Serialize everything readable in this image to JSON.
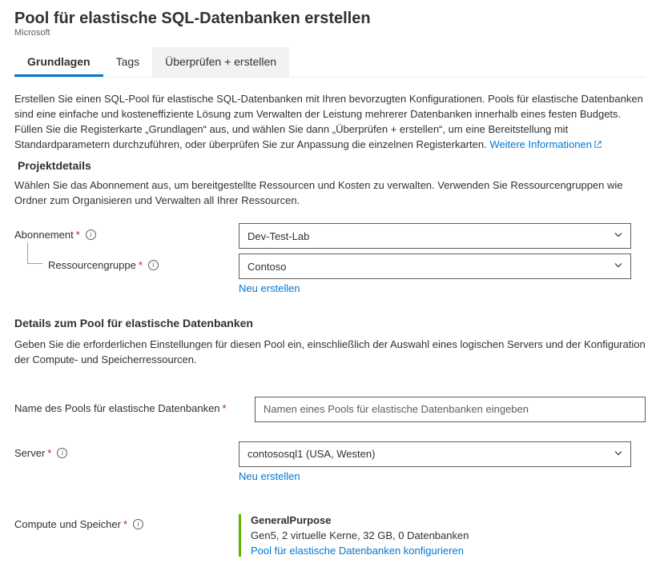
{
  "header": {
    "title": "Pool für elastische SQL-Datenbanken erstellen",
    "vendor": "Microsoft"
  },
  "tabs": {
    "basics": "Grundlagen",
    "tags": "Tags",
    "review": "Überprüfen + erstellen"
  },
  "intro": {
    "text": "Erstellen Sie einen SQL-Pool für elastische SQL-Datenbanken mit Ihren bevorzugten Konfigurationen. Pools für elastische Datenbanken sind eine einfache und kosteneffiziente Lösung zum Verwalten der Leistung mehrerer Datenbanken innerhalb eines festen Budgets. Füllen Sie die Registerkarte „Grundlagen“ aus, und wählen Sie dann „Überprüfen + erstellen“, um eine Bereitstellung mit Standardparametern durchzuführen, oder überprüfen Sie zur Anpassung die einzelnen Registerkarten. ",
    "link": "Weitere Informationen"
  },
  "project": {
    "heading": "Projektdetails",
    "desc": "Wählen Sie das Abonnement aus, um bereitgestellte Ressourcen und Kosten zu verwalten. Verwenden Sie Ressourcengruppen wie Ordner zum Organisieren und Verwalten all Ihrer Ressourcen.",
    "subscription_label": "Abonnement",
    "subscription_value": "Dev-Test-Lab",
    "rg_label": "Ressourcengruppe",
    "rg_value": "Contoso",
    "create_new": "Neu erstellen"
  },
  "pool": {
    "heading": "Details zum Pool für elastische Datenbanken",
    "desc": "Geben Sie die erforderlichen Einstellungen für diesen Pool ein, einschließlich der Auswahl eines logischen Servers und der Konfiguration der Compute- und Speicherressourcen.",
    "name_label": "Name des Pools für elastische Datenbanken",
    "name_placeholder": "Namen eines Pools für elastische Datenbanken eingeben",
    "server_label": "Server",
    "server_value": "contososql1 (USA, Westen)",
    "create_new": "Neu erstellen",
    "compute_label": "Compute und Speicher",
    "compute_title": "GeneralPurpose",
    "compute_detail": "Gen5, 2 virtuelle Kerne, 32 GB, 0 Datenbanken",
    "compute_link": "Pool für elastische Datenbanken konfigurieren"
  }
}
